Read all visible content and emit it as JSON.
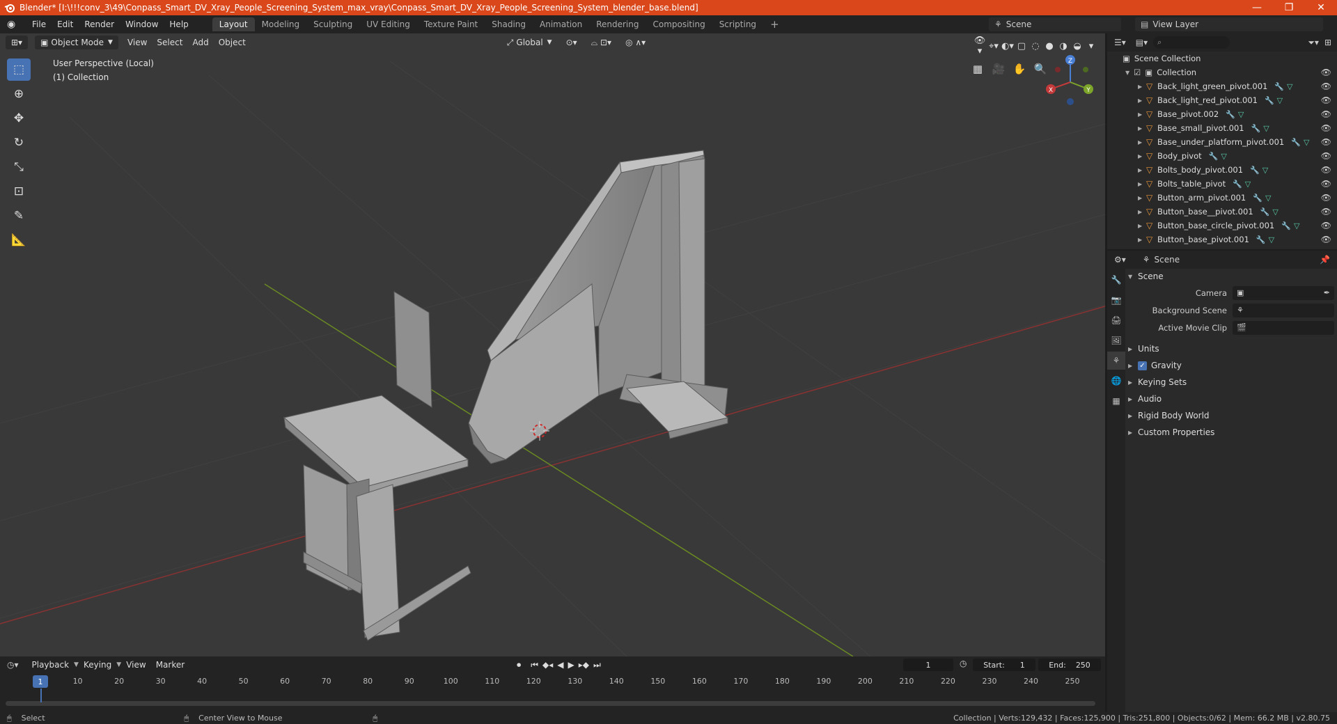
{
  "window": {
    "title": "Blender* [I:\\!!!conv_3\\49\\Conpass_Smart_DV_Xray_People_Screening_System_max_vray\\Conpass_Smart_DV_Xray_People_Screening_System_blender_base.blend]",
    "minimize": "—",
    "maximize": "❐",
    "close": "✕"
  },
  "menu": [
    "File",
    "Edit",
    "Render",
    "Window",
    "Help"
  ],
  "workspaces": [
    "Layout",
    "Modeling",
    "Sculpting",
    "UV Editing",
    "Texture Paint",
    "Shading",
    "Animation",
    "Rendering",
    "Compositing",
    "Scripting"
  ],
  "scene_name": "Scene",
  "view_layer": "View Layer",
  "viewport": {
    "mode": "Object Mode",
    "menus": [
      "View",
      "Select",
      "Add",
      "Object"
    ],
    "transform_orientation": "Global",
    "perspective_label": "User Perspective (Local)",
    "collection_label": "(1) Collection"
  },
  "gizmo": {
    "x": "X",
    "y": "Y",
    "z": "Z"
  },
  "outliner": {
    "root": "Scene Collection",
    "collection": "Collection",
    "items": [
      "Back_light_green_pivot.001",
      "Back_light_red_pivot.001",
      "Base_pivot.002",
      "Base_small_pivot.001",
      "Base_under_platform_pivot.001",
      "Body_pivot",
      "Bolts_body_pivot.001",
      "Bolts_table_pivot",
      "Button_arm_pivot.001",
      "Button_base__pivot.001",
      "Button_base_circle_pivot.001",
      "Button_base_pivot.001"
    ]
  },
  "properties": {
    "context": "Scene",
    "panel": "Scene",
    "fields": [
      {
        "label": "Camera",
        "value": ""
      },
      {
        "label": "Background Scene",
        "value": ""
      },
      {
        "label": "Active Movie Clip",
        "value": ""
      }
    ],
    "subpanels": [
      "Units",
      "Gravity",
      "Keying Sets",
      "Audio",
      "Rigid Body World",
      "Custom Properties"
    ]
  },
  "timeline": {
    "menus": [
      "Playback",
      "Keying",
      "View",
      "Marker"
    ],
    "current_frame": "1",
    "start_label": "Start:",
    "start": "1",
    "end_label": "End:",
    "end": "250",
    "ticks": [
      "10",
      "20",
      "30",
      "40",
      "50",
      "60",
      "70",
      "80",
      "90",
      "100",
      "110",
      "120",
      "130",
      "140",
      "150",
      "160",
      "170",
      "180",
      "190",
      "200",
      "210",
      "220",
      "230",
      "240",
      "250"
    ]
  },
  "status": {
    "left": "Select",
    "mid": "Center View to Mouse",
    "right": "Collection | Verts:129,432 | Faces:125,900 | Tris:251,800 | Objects:0/62 | Mem: 66.2 MB | v2.80.75"
  },
  "colors": {
    "accent": "#4772b3",
    "titlebar": "#d9471a",
    "x_axis": "#c43a3a",
    "y_axis": "#7da52a",
    "object_icon": "#e8963c"
  }
}
